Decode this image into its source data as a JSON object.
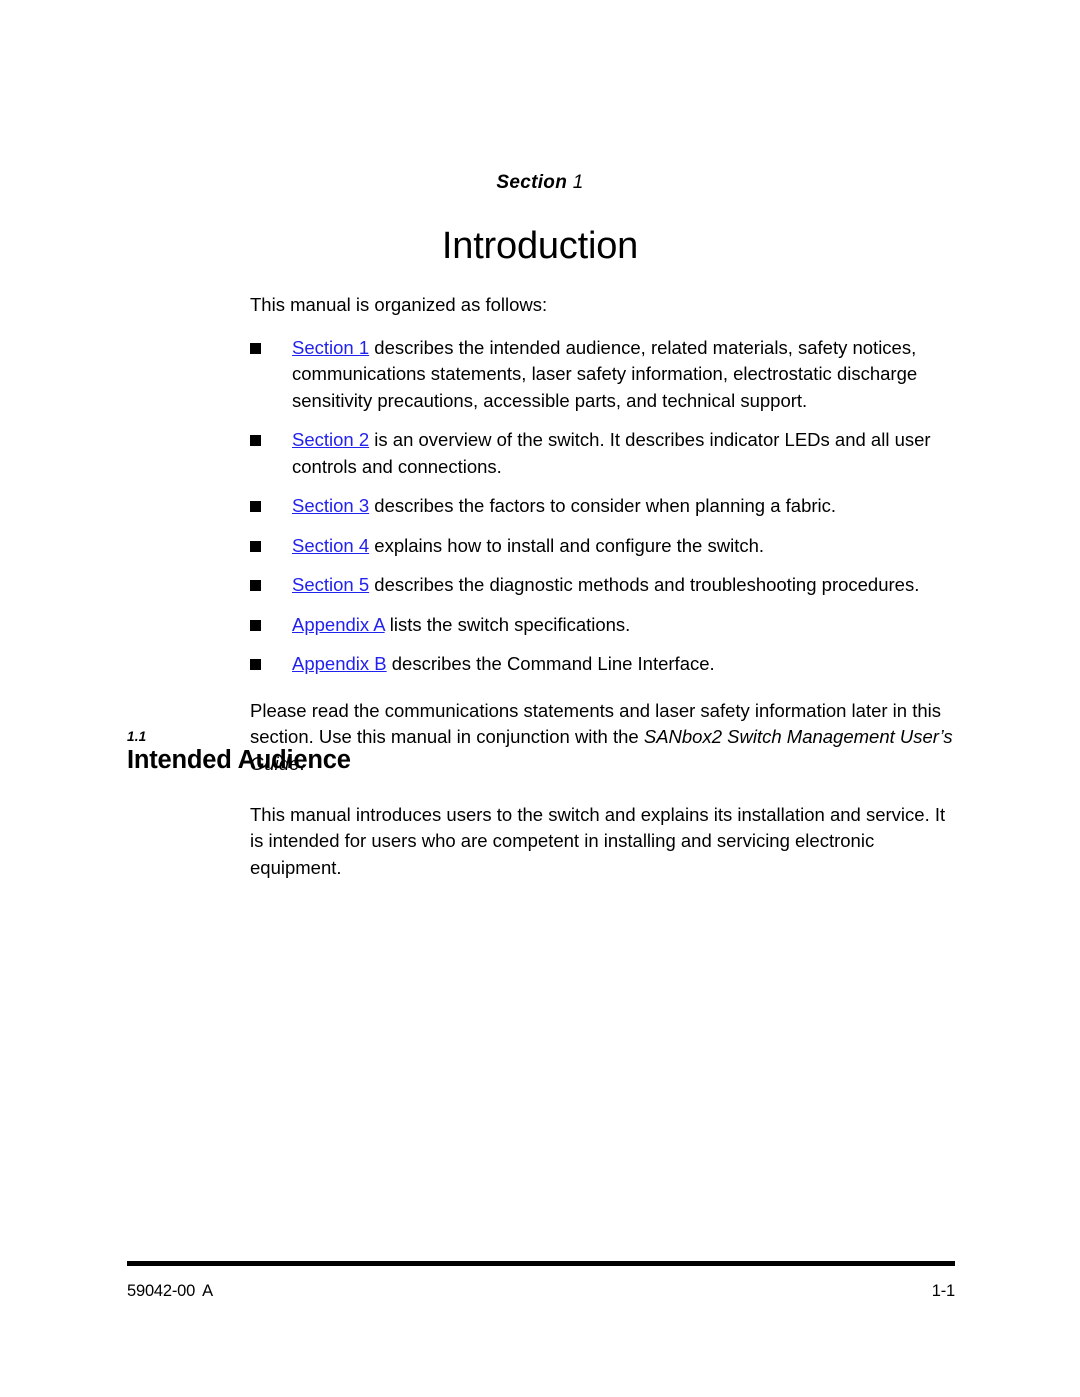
{
  "document": {
    "section_kicker_label": "Section",
    "section_kicker_number": "1",
    "section_title": "Introduction",
    "link_color": "#2222ee",
    "bullet_color": "#000000"
  },
  "intro": {
    "lead_line": "This manual is organized as follows:"
  },
  "bullets": [
    {
      "link": "Section 1",
      "text": " describes the intended audience, related materials, safety notices, communications statements, laser safety information, electrostatic discharge sensitivity precautions, accessible parts, and technical support."
    },
    {
      "link": "Section 2",
      "text": " is an overview of the switch. It describes indicator LEDs and all user controls and connections."
    },
    {
      "link": "Section 3",
      "text": " describes the factors to consider when planning a fabric."
    },
    {
      "link": "Section 4",
      "text": " explains how to install and configure the switch."
    },
    {
      "link": "Section 5",
      "text": " describes the diagnostic methods and troubleshooting procedures."
    },
    {
      "link": "Appendix A",
      "text": " lists the switch specifications."
    },
    {
      "link": "Appendix B",
      "text": " describes the Command Line Interface."
    }
  ],
  "closing_paragraph": {
    "part1": "Please read the communications statements and laser safety information later in this section. Use this manual in conjunction with the ",
    "italic": "SANbox2 Switch Management User’s Guide",
    "part2": "."
  },
  "section_1_1": {
    "number": "1.1",
    "title": "Intended Audience",
    "body": "This manual introduces users to the switch and explains its installation and service. It is intended for users who are competent in installing and servicing electronic equipment."
  },
  "footer": {
    "document_number": "59042-00",
    "revision": "A",
    "page_number": "1-1"
  }
}
